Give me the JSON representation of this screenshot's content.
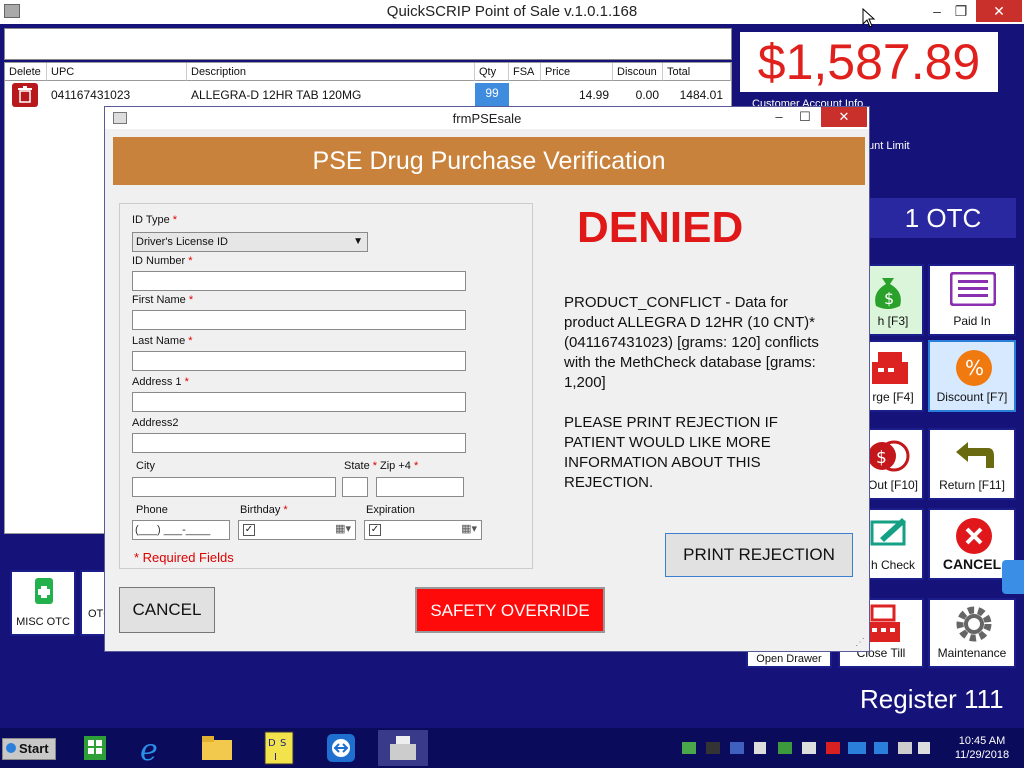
{
  "window": {
    "title": "QuickSCRIP Point of Sale   v.1.0.1.168",
    "minimize": "–",
    "maximize": "❐",
    "close": "✕"
  },
  "grid": {
    "headers": [
      "Delete",
      "UPC",
      "Description",
      "Qty",
      "FSA",
      "Price",
      "Discoun",
      "Total"
    ],
    "row": {
      "upc": "041167431023",
      "description": "ALLEGRA-D 12HR TAB 120MG",
      "qty": "99",
      "fsa": "",
      "price": "14.99",
      "discount": "0.00",
      "total": "1484.01"
    }
  },
  "summary": {
    "total": "$1,587.89",
    "account_info": "Customer Account Info",
    "limit": "unt Limit",
    "otc_count": "1 OTC"
  },
  "tiles": {
    "cash": "h [F3]",
    "paid_in": "Paid In",
    "charge": "rge [F4]",
    "discount": "Discount [F7]",
    "cash_out": "Out [F10]",
    "return": "Return [F11]",
    "check": "h Check",
    "cancel": "CANCEL",
    "open_drawer": "Open Drawer",
    "close_till": "Close Till",
    "maintenance": "Maintenance",
    "misc_otc": "MISC OTC",
    "otc_tax": "OTC TAX"
  },
  "register": "Register 111",
  "dialog": {
    "title": "frmPSEsale",
    "minimize": "–",
    "maximize": "☐",
    "close": "✕",
    "banner": "PSE Drug Purchase Verification",
    "form": {
      "id_type_label": "ID Type",
      "id_type_value": "Driver's License ID",
      "id_number_label": "ID Number",
      "first_name_label": "First Name",
      "last_name_label": "Last Name",
      "address1_label": "Address 1",
      "address2_label": "Address2",
      "city_label": "City",
      "state_label": "State",
      "zip_label": "Zip +4",
      "phone_label": "Phone",
      "phone_value": "(___) ___-____",
      "birthday_label": "Birthday",
      "expiration_label": "Expiration",
      "required_star": "*",
      "required_note": "*  Required Fields"
    },
    "status": "DENIED",
    "message1": "PRODUCT_CONFLICT - Data for product ALLEGRA D 12HR (10 CNT)* (041167431023) [grams: 120] conflicts with the MethCheck database [grams: 1,200]",
    "message2": "PLEASE PRINT REJECTION IF PATIENT WOULD LIKE MORE INFORMATION ABOUT THIS REJECTION.",
    "print_button": "PRINT REJECTION",
    "cancel_button": "CANCEL",
    "override_button": "SAFETY OVERRIDE"
  },
  "taskbar": {
    "start": "Start",
    "time": "10:45 AM",
    "date": "11/29/2018"
  },
  "colors": {
    "background": "#15137a",
    "banner": "#c8823c",
    "denied": "#e01818",
    "override": "#ff0a0a",
    "total": "#e0201c"
  }
}
